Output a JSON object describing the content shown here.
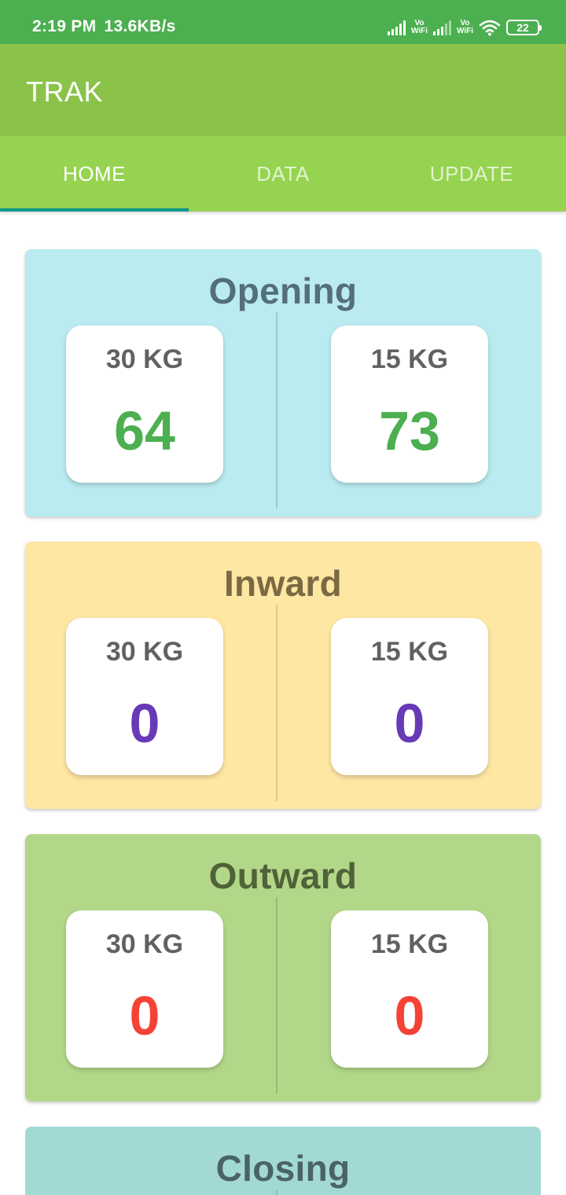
{
  "status_bar": {
    "time": "2:19 PM",
    "speed": "13.6KB/s",
    "vowifi_1": "Vo\nWiFi",
    "vowifi_2": "Vo\nWiFi",
    "battery": "22"
  },
  "app_bar": {
    "title": "TRAK"
  },
  "tabs": [
    {
      "label": "HOME",
      "active": true
    },
    {
      "label": "DATA",
      "active": false
    },
    {
      "label": "UPDATE",
      "active": false
    }
  ],
  "colors": {
    "status_bar": "#4caf50",
    "app_bar": "#8bc34a",
    "tab_bar": "#96d350",
    "tab_indicator": "#009688",
    "opening_bg": "#b9ebf0",
    "inward_bg": "#fee6a3",
    "outward_bg": "#b2d788",
    "closing_bg": "#a3d9d5",
    "value_green": "#4caf50",
    "value_purple": "#673ab7",
    "value_red": "#f44336"
  },
  "cards": [
    {
      "title": "Opening",
      "left_label": "30 KG",
      "left_value": "64",
      "right_label": "15 KG",
      "right_value": "73"
    },
    {
      "title": "Inward",
      "left_label": "30 KG",
      "left_value": "0",
      "right_label": "15 KG",
      "right_value": "0"
    },
    {
      "title": "Outward",
      "left_label": "30 KG",
      "left_value": "0",
      "right_label": "15 KG",
      "right_value": "0"
    },
    {
      "title": "Closing"
    }
  ]
}
